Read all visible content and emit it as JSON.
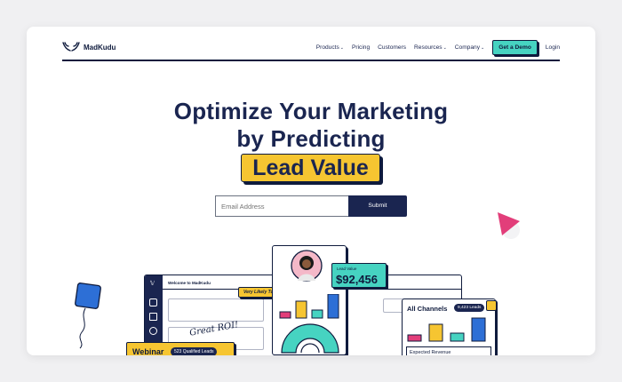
{
  "brand": {
    "name": "MadKudu"
  },
  "nav": {
    "items": [
      {
        "label": "Products",
        "dropdown": true
      },
      {
        "label": "Pricing",
        "dropdown": false
      },
      {
        "label": "Customers",
        "dropdown": false
      },
      {
        "label": "Resources",
        "dropdown": true
      },
      {
        "label": "Company",
        "dropdown": true
      }
    ],
    "demo_label": "Get a Demo",
    "login_label": "Login"
  },
  "hero": {
    "line1": "Optimize Your Marketing",
    "line2": "by Predicting",
    "highlight": "Lead Value"
  },
  "form": {
    "email_placeholder": "Email Address",
    "submit_label": "Submit"
  },
  "illustration": {
    "app_title": "Welcome to MadKudu",
    "likely_tag": "Very Likely To Buy",
    "handwriting": "Great ROI!",
    "lead_value_label": "Lead Value",
    "lead_value": "$92,456",
    "channels_title": "All Channels",
    "channels_badge": "9,423 Leads",
    "expected_revenue": "Expected Revenue",
    "webinar_label": "Webinar",
    "webinar_badge": "523 Qualified Leads"
  },
  "colors": {
    "navy": "#1a2550",
    "teal": "#46d3c1",
    "yellow": "#f6c531",
    "blue": "#2d6fd6",
    "pink": "#e23e7a"
  }
}
